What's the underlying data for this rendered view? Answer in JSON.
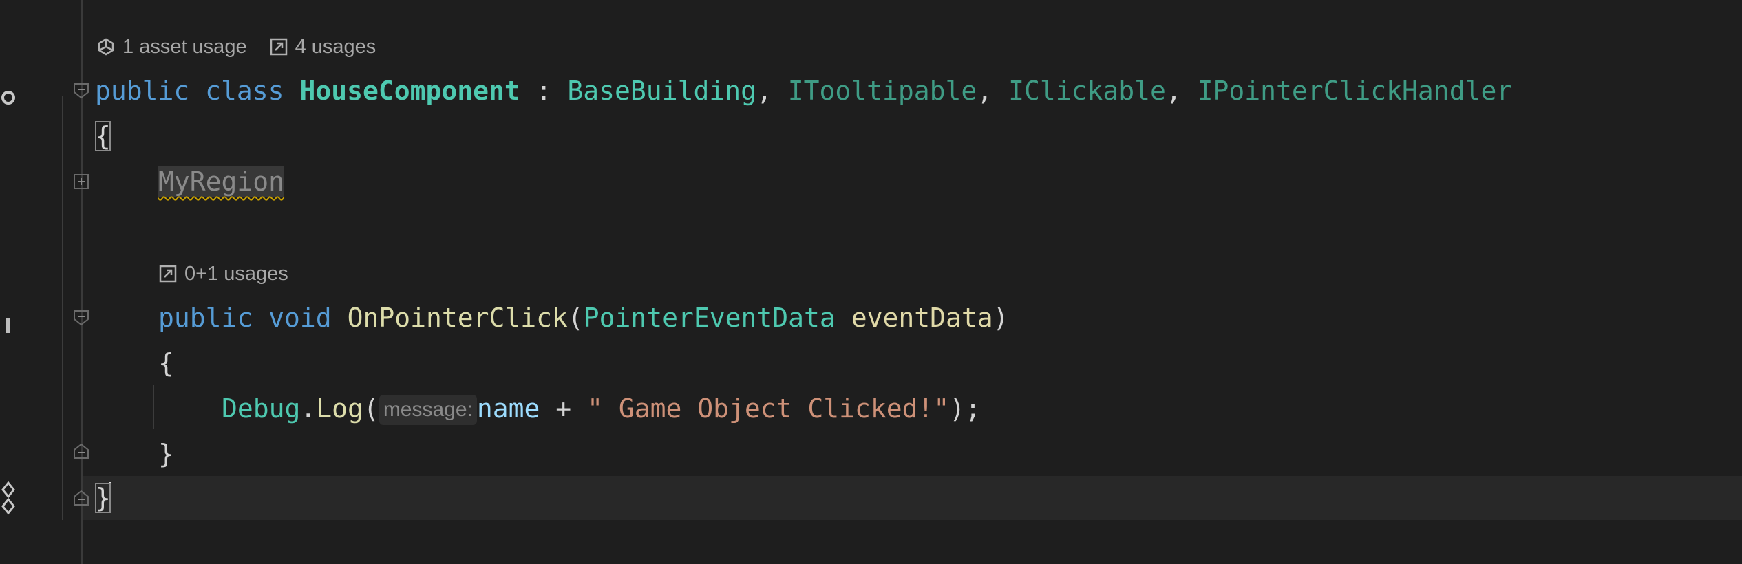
{
  "codelens": {
    "class": {
      "asset_usage": "1 asset usage",
      "usages": "4 usages"
    },
    "method": {
      "usages": "0+1 usages"
    }
  },
  "code": {
    "line1": {
      "kw_public": "public",
      "kw_class": "class",
      "class_name": "HouseComponent",
      "colon": ":",
      "base": "BaseBuilding",
      "comma1": ",",
      "iface1": "ITooltipable",
      "comma2": ",",
      "iface2": "IClickable",
      "comma3": ",",
      "iface3": "IPointerClickHandler"
    },
    "open_brace": "{",
    "region": "MyRegion",
    "method_line": {
      "kw_public": "public",
      "kw_void": "void",
      "name": "OnPointerClick",
      "paren_open": "(",
      "param_type": "PointerEventData",
      "param_name": "eventData",
      "paren_close": ")"
    },
    "method_open": "{",
    "body": {
      "cls": "Debug",
      "dot": ".",
      "method": "Log",
      "paren_open": "(",
      "hint": "message:",
      "arg": "name",
      "plus": "+",
      "string": "\" Game Object Clicked!\"",
      "end": ");"
    },
    "method_close": "}",
    "close_brace": "}"
  },
  "colors": {
    "background": "#1e1e1e",
    "keyword": "#569cd6",
    "type": "#4ec9b0",
    "method": "#dcdcaa",
    "string": "#ce9178"
  }
}
